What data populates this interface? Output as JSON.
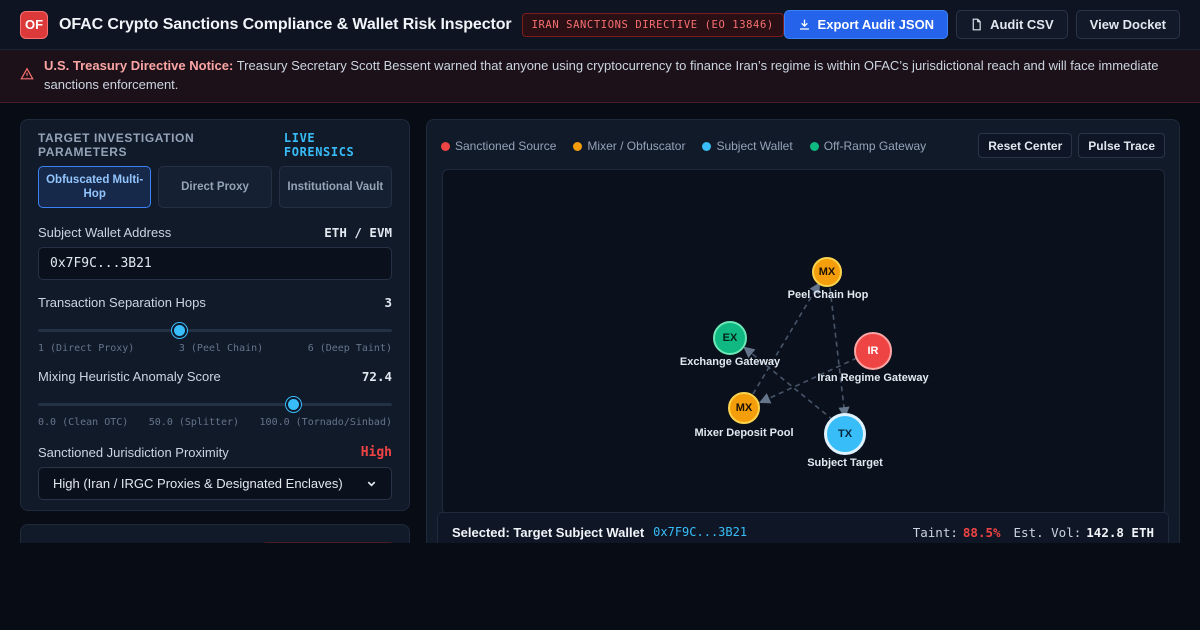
{
  "header": {
    "logo": "OF",
    "title": "OFAC Crypto Sanctions Compliance & Wallet Risk Inspector",
    "directive_badge": "IRAN SANCTIONS DIRECTIVE (EO 13846)",
    "export_json": "Export Audit JSON",
    "audit_csv": "Audit CSV",
    "view_docket": "View Docket"
  },
  "notice": {
    "label": "U.S. Treasury Directive Notice:",
    "text": "Treasury Secretary Scott Bessent warned that anyone using cryptocurrency to finance Iran’s regime is within OFAC’s jurisdictional reach and will face immediate sanctions enforcement."
  },
  "params": {
    "title": "TARGET INVESTIGATION PARAMETERS",
    "live_tag": "LIVE FORENSICS",
    "modes": [
      "Obfuscated Multi-Hop",
      "Direct Proxy",
      "Institutional Vault"
    ],
    "active_mode": 0,
    "wallet_label": "Subject Wallet Address",
    "chain": "ETH / EVM",
    "wallet_value": "0x7F9C...3B21",
    "hops_label": "Transaction Separation Hops",
    "hops_value": "3",
    "hops_fraction": 0.4,
    "hops_ticks": [
      "1 (Direct Proxy)",
      "3 (Peel Chain)",
      "6 (Deep Taint)"
    ],
    "mixing_label": "Mixing Heuristic Anomaly Score",
    "mixing_value": "72.4",
    "mixing_fraction": 0.724,
    "mixing_ticks": [
      "0.0 (Clean OTC)",
      "50.0 (Splitter)",
      "100.0 (Tornado/Sinbad)"
    ],
    "jurisdiction_label": "Sanctioned Jurisdiction Proximity",
    "jurisdiction_value": "High",
    "jurisdiction_select": "High (Iran / IRGC Proxies & Designated Enclaves)"
  },
  "graph": {
    "legend": [
      {
        "label": "Sanctioned Source",
        "color": "#ef4444"
      },
      {
        "label": "Mixer / Obfuscator",
        "color": "#f59e0b"
      },
      {
        "label": "Subject Wallet",
        "color": "#38bdf8"
      },
      {
        "label": "Off-Ramp Gateway",
        "color": "#10b981"
      }
    ],
    "reset_center": "Reset Center",
    "pulse_trace": "Pulse Trace",
    "nodes": [
      {
        "code": "MX",
        "label": "Peel Chain Hop",
        "kind": "mixer"
      },
      {
        "code": "EX",
        "label": "Exchange Gateway",
        "kind": "offramp"
      },
      {
        "code": "IR",
        "label": "Iran Regime Gateway",
        "kind": "sanctioned"
      },
      {
        "code": "MX",
        "label": "Mixer Deposit Pool",
        "kind": "mixer"
      },
      {
        "code": "TX",
        "label": "Subject Target",
        "kind": "subject"
      }
    ]
  },
  "status": {
    "selected": "Selected: Target Subject Wallet",
    "address": "0x7F9C...3B21",
    "taint_label": "Taint:",
    "taint_value": "88.5%",
    "vol_label": "Est. Vol:",
    "vol_value": "142.8 ETH"
  },
  "colors": {
    "sanctioned": "#ef4444",
    "mixer": "#f59e0b",
    "subject": "#38bdf8",
    "offramp": "#10b981",
    "accent": "#2563eb"
  }
}
